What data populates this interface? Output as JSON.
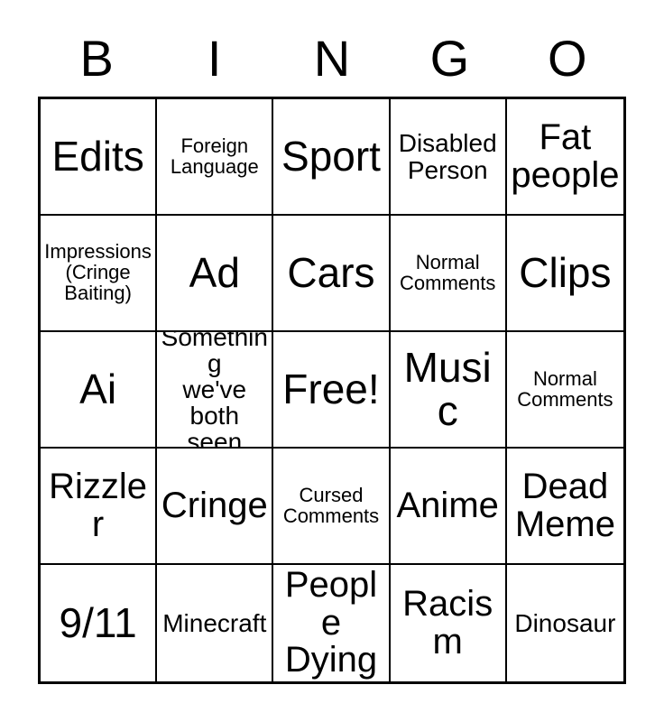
{
  "card": {
    "header_letters": [
      "B",
      "I",
      "N",
      "G",
      "O"
    ],
    "colors": {
      "background": "#ffffff",
      "text": "#000000",
      "border": "#000000"
    },
    "cells": [
      {
        "text": "Edits",
        "size": "fs-xl"
      },
      {
        "text": "Foreign\nLanguage",
        "size": "fs-sm"
      },
      {
        "text": "Sport",
        "size": "fs-xl"
      },
      {
        "text": "Disabled\nPerson",
        "size": "fs-md"
      },
      {
        "text": "Fat\npeople",
        "size": "fs-lg"
      },
      {
        "text": "Impressions\n(Cringe\nBaiting)",
        "size": "fs-sm"
      },
      {
        "text": "Ad",
        "size": "fs-xl"
      },
      {
        "text": "Cars",
        "size": "fs-xl"
      },
      {
        "text": "Normal\nComments",
        "size": "fs-sm"
      },
      {
        "text": "Clips",
        "size": "fs-xl"
      },
      {
        "text": "Ai",
        "size": "fs-xl"
      },
      {
        "text": "Something\nwe've both\nseen",
        "size": "fs-md"
      },
      {
        "text": "Free!",
        "size": "fs-xl"
      },
      {
        "text": "Music",
        "size": "fs-xl"
      },
      {
        "text": "Normal\nComments",
        "size": "fs-sm"
      },
      {
        "text": "Rizzler",
        "size": "fs-lg"
      },
      {
        "text": "Cringe",
        "size": "fs-lg"
      },
      {
        "text": "Cursed\nComments",
        "size": "fs-sm"
      },
      {
        "text": "Anime",
        "size": "fs-lg"
      },
      {
        "text": "Dead\nMeme",
        "size": "fs-lg"
      },
      {
        "text": "9/11",
        "size": "fs-xl"
      },
      {
        "text": "Minecraft",
        "size": "fs-md"
      },
      {
        "text": "People\nDying",
        "size": "fs-lg"
      },
      {
        "text": "Racism",
        "size": "fs-lg"
      },
      {
        "text": "Dinosaur",
        "size": "fs-md"
      }
    ]
  }
}
